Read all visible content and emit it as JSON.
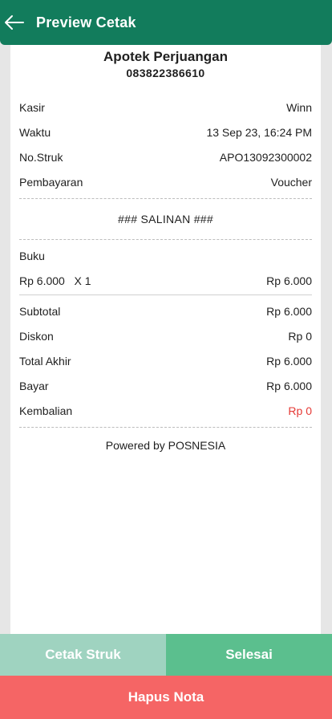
{
  "appbar": {
    "title": "Preview Cetak",
    "back_icon": "arrow-left-icon",
    "bg_color": "#127c5c"
  },
  "receipt": {
    "store_name": "Apotek Perjuangan",
    "store_phone": "083822386610",
    "info": [
      {
        "label": "Kasir",
        "value": "Winn"
      },
      {
        "label": "Waktu",
        "value": "13 Sep 23, 16:24 PM"
      },
      {
        "label": "No.Struk",
        "value": "APO13092300002"
      },
      {
        "label": "Pembayaran",
        "value": "Voucher"
      }
    ],
    "copy_label": "### SALINAN ###",
    "items": [
      {
        "name": "Buku",
        "price_qty": "Rp 6.000   X 1",
        "total": "Rp 6.000"
      }
    ],
    "totals": [
      {
        "label": "Subtotal",
        "value": "Rp 6.000"
      },
      {
        "label": "Diskon",
        "value": "Rp 0"
      },
      {
        "label": "Total Akhir",
        "value": "Rp 6.000"
      },
      {
        "label": "Bayar",
        "value": "Rp 6.000"
      },
      {
        "label": "Kembalian",
        "value": "Rp 0"
      }
    ],
    "change_color": "#e53935",
    "powered_by": "Powered by POSNESIA"
  },
  "footer": {
    "print_label": "Cetak Struk",
    "done_label": "Selesai",
    "delete_label": "Hapus Nota",
    "colors": {
      "print": "#9fd3c0",
      "done": "#5bbf8e",
      "delete": "#f56565"
    }
  }
}
